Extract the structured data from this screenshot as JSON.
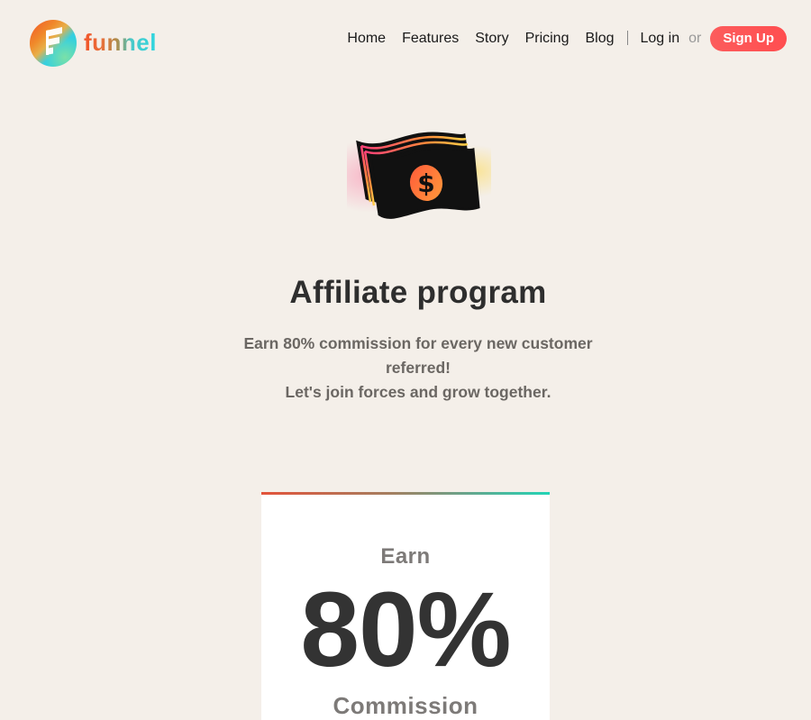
{
  "brand": {
    "name": "funnel",
    "logo_icon": "funnel-logo-icon"
  },
  "nav": {
    "items": [
      {
        "label": "Home"
      },
      {
        "label": "Features"
      },
      {
        "label": "Story"
      },
      {
        "label": "Pricing"
      },
      {
        "label": "Blog"
      }
    ],
    "login_label": "Log in",
    "or_label": "or",
    "signup_label": "Sign Up"
  },
  "hero": {
    "illustration": "money-bills-icon",
    "title": "Affiliate program",
    "subtitle_line1": "Earn 80% commission for every new customer referred!",
    "subtitle_line2": "Let's join forces and grow together."
  },
  "card": {
    "earn_label": "Earn",
    "percent_value": "80%",
    "commission_label": "Commission"
  },
  "colors": {
    "background": "#f4efe9",
    "signup_button": "#ff5a55",
    "card_bar_start": "#e3533a",
    "card_bar_end": "#22d4b6",
    "title_text": "#2e2e2e",
    "subtitle_text": "#6b6763"
  }
}
